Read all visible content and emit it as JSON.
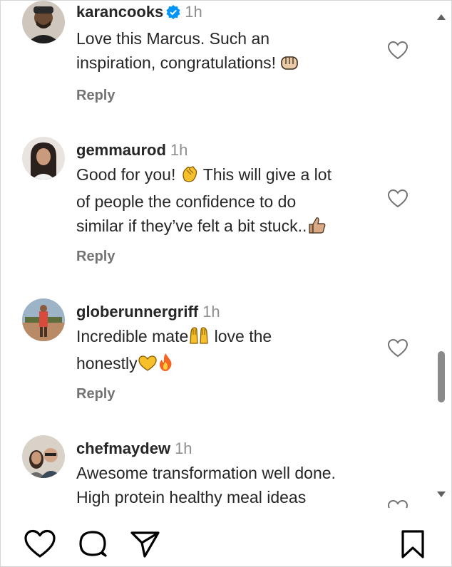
{
  "comments": [
    {
      "username": "karancooks",
      "verified": true,
      "time": "1h",
      "lines": [
        "Love this Marcus. Such an",
        "inspiration, congratulations!"
      ],
      "reply": "Reply"
    },
    {
      "username": "gemmaurod",
      "time": "1h",
      "lines": [
        "Good for you!",
        "This will give a lot",
        "of people the confidence to do",
        "similar if they’ve felt a bit stuck.."
      ],
      "reply": "Reply"
    },
    {
      "username": "globerunnergriff",
      "time": "1h",
      "lines": [
        "Incredible mate",
        "love the",
        "honestly"
      ],
      "reply": "Reply"
    },
    {
      "username": "chefmaydew",
      "time": "1h",
      "lines": [
        "Awesome transformation well done.",
        "High protein healthy meal ideas"
      ]
    }
  ],
  "icons": {
    "verified": "verified-badge-icon",
    "like_comment": "heart-outline-icon",
    "bottom": [
      "heart-icon",
      "comment-icon",
      "share-icon",
      "bookmark-icon"
    ]
  },
  "colors": {
    "verified": "#0095f6",
    "text": "#262626",
    "muted": "#8e8e8e",
    "scroll_thumb": "#8a8a8a"
  }
}
